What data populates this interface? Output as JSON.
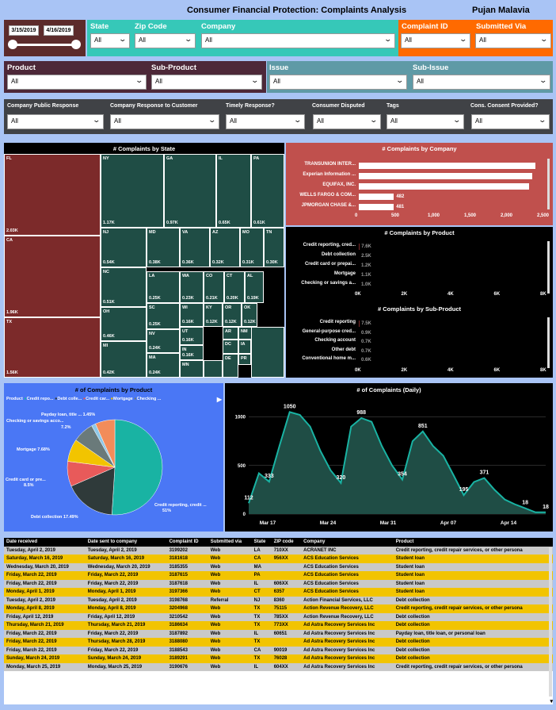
{
  "header": {
    "title": "Consumer Financial Protection: Complaints Analysis",
    "user": "Pujan Malavia"
  },
  "filters": {
    "date_from": "3/15/2019",
    "date_to": "4/16/2019",
    "row1": [
      {
        "label": "State",
        "value": "All"
      },
      {
        "label": "Zip Code",
        "value": "All"
      },
      {
        "label": "Company",
        "value": "All"
      },
      {
        "label": "Complaint ID",
        "value": "All"
      },
      {
        "label": "Submitted Via",
        "value": "All"
      }
    ],
    "row2": [
      {
        "label": "Product",
        "value": "All"
      },
      {
        "label": "Sub-Product",
        "value": "All"
      },
      {
        "label": "Issue",
        "value": "All"
      },
      {
        "label": "Sub-Issue",
        "value": "All"
      }
    ],
    "row3": [
      {
        "label": "Company Public Response",
        "value": "All"
      },
      {
        "label": "Company Response to Customer",
        "value": "All"
      },
      {
        "label": "Timely Response?",
        "value": "All"
      },
      {
        "label": "Consumer Disputed",
        "value": "All"
      },
      {
        "label": "Tags",
        "value": "All"
      },
      {
        "label": "Cons. Consent Provided?",
        "value": "All"
      }
    ]
  },
  "treemap": {
    "title": "# Complaints by State",
    "cells": [
      {
        "n": "FL",
        "v": "2.03K"
      },
      {
        "n": "CA",
        "v": "1.96K"
      },
      {
        "n": "TX",
        "v": "1.56K"
      },
      {
        "n": "NY",
        "v": "1.17K"
      },
      {
        "n": "GA",
        "v": "0.97K"
      },
      {
        "n": "IL",
        "v": "0.65K"
      },
      {
        "n": "PA",
        "v": "0.61K"
      },
      {
        "n": "NJ",
        "v": "0.54K"
      },
      {
        "n": "MD",
        "v": "0.38K"
      },
      {
        "n": "VA",
        "v": "0.36K"
      },
      {
        "n": "AZ",
        "v": "0.32K"
      },
      {
        "n": "MO",
        "v": "0.31K"
      },
      {
        "n": "TN",
        "v": "0.30K"
      },
      {
        "n": "NC",
        "v": "0.51K"
      },
      {
        "n": "LA",
        "v": "0.25K"
      },
      {
        "n": "WA",
        "v": "0.23K"
      },
      {
        "n": "CO",
        "v": "0.21K"
      },
      {
        "n": "CT",
        "v": "0.20K"
      },
      {
        "n": "AL",
        "v": "0.19K"
      },
      {
        "n": "OH",
        "v": "0.46K"
      },
      {
        "n": "SC",
        "v": "0.25K"
      },
      {
        "n": "WI",
        "v": "0.16K"
      },
      {
        "n": "KY",
        "v": "0.12K"
      },
      {
        "n": "OR",
        "v": "0.12K"
      },
      {
        "n": "OK",
        "v": "0.12K"
      },
      {
        "n": "NV",
        "v": "0.24K"
      },
      {
        "n": "UT",
        "v": "0.16K"
      },
      {
        "n": "AR",
        "v": ""
      },
      {
        "n": "NM",
        "v": ""
      },
      {
        "n": "MI",
        "v": "0.42K"
      },
      {
        "n": "MA",
        "v": "0.24K"
      },
      {
        "n": "IN",
        "v": "0.16K"
      },
      {
        "n": "DC",
        "v": ""
      },
      {
        "n": "IA",
        "v": ""
      },
      {
        "n": "MN",
        "v": ""
      },
      {
        "n": "DE",
        "v": ""
      },
      {
        "n": "PR",
        "v": ""
      }
    ]
  },
  "by_company": {
    "title": "# Complaints by Company",
    "labels": [
      "TRANSUNION INTER...",
      "Experian Information ...",
      "EQUIFAX, INC.",
      "WELLS FARGO & COM...",
      "JPMORGAN CHASE &..."
    ],
    "values": [
      2420,
      2380,
      2340,
      482,
      481
    ],
    "value_labels": [
      "",
      "",
      "",
      "482",
      "481"
    ],
    "ticks": [
      "0",
      "500",
      "1,000",
      "1,500",
      "2,000",
      "2,500"
    ]
  },
  "by_product": {
    "title": "# Complaints by Product",
    "labels": [
      "Credit reporting, cred...",
      "Debt collection",
      "Credit card or prepai...",
      "Mortgage",
      "Checking or savings a..."
    ],
    "values": [
      7.6,
      2.5,
      1.2,
      1.1,
      1.0
    ],
    "value_labels": [
      "7.6K",
      "2.5K",
      "1.2K",
      "1.1K",
      "1.0K"
    ],
    "ticks": [
      "0K",
      "2K",
      "4K",
      "6K",
      "8K"
    ]
  },
  "by_subproduct": {
    "title": "# Complaints by Sub-Product",
    "labels": [
      "Credit reporting",
      "General-purpose cred...",
      "Checking account",
      "Other debt",
      "Conventional home m..."
    ],
    "values": [
      7.5,
      0.9,
      0.7,
      0.7,
      0.6
    ],
    "value_labels": [
      "7.5K",
      "0.9K",
      "0.7K",
      "0.7K",
      "0.6K"
    ],
    "ticks": [
      "0K",
      "2K",
      "4K",
      "6K",
      "8K"
    ]
  },
  "pie": {
    "title": "# of Complaints by Product",
    "legend_title": "Product",
    "legend": [
      "Credit repo...",
      "Debt colle...",
      "Credit car...",
      "Mortgage",
      "Checking ..."
    ],
    "slices": [
      {
        "name": "Credit reporting, credit ...",
        "pct": 51,
        "label": "51%",
        "color": "#19b3a3"
      },
      {
        "name": "Debt collection",
        "pct": 17.49,
        "label": "17.49%",
        "color": "#2f3a3a"
      },
      {
        "name": "Credit card or pre...",
        "pct": 8.5,
        "label": "8.5%",
        "color": "#e85a5a"
      },
      {
        "name": "Mortgage",
        "pct": 7.68,
        "label": "7.68%",
        "color": "#f2c400"
      },
      {
        "name": "Checking or savings acco...",
        "pct": 7.2,
        "label": "7.2%",
        "color": "#6a7a7a"
      },
      {
        "name": "Payday loan, title ...",
        "pct": 1.45,
        "label": "1.45%",
        "color": "#8ec8e8"
      },
      {
        "name": "Other",
        "pct": 6.68,
        "label": "",
        "color": "#f28c5a"
      }
    ]
  },
  "daily": {
    "title": "# of Complaints (Daily)",
    "yticks": [
      "0",
      "500",
      "1000"
    ],
    "xticks": [
      "Mar 17",
      "Mar 24",
      "Mar 31",
      "Apr 07",
      "Apr 14"
    ],
    "values": [
      112,
      420,
      333,
      700,
      1050,
      1020,
      900,
      650,
      450,
      320,
      900,
      988,
      950,
      700,
      500,
      354,
      750,
      851,
      700,
      600,
      400,
      195,
      330,
      371,
      250,
      150,
      100,
      60,
      18,
      18
    ],
    "labels": [
      {
        "i": 0,
        "t": "112"
      },
      {
        "i": 2,
        "t": "333"
      },
      {
        "i": 4,
        "t": "1050"
      },
      {
        "i": 9,
        "t": "320"
      },
      {
        "i": 11,
        "t": "988"
      },
      {
        "i": 15,
        "t": "354"
      },
      {
        "i": 17,
        "t": "851"
      },
      {
        "i": 21,
        "t": "195"
      },
      {
        "i": 23,
        "t": "371"
      },
      {
        "i": 27,
        "t": "18"
      },
      {
        "i": 29,
        "t": "18"
      }
    ]
  },
  "table": {
    "headers": [
      "Date received",
      "Date sent to company",
      "Complaint ID",
      "Submitted via",
      "State",
      "ZIP code",
      "Company",
      "Product"
    ],
    "rows": [
      [
        "Tuesday, April 2, 2019",
        "Tuesday, April 2, 2019",
        "3199202",
        "Web",
        "LA",
        "710XX",
        "ACRANET INC",
        "Credit reporting, credit repair services, or other persona"
      ],
      [
        "Saturday, March 16, 2019",
        "Saturday, March 16, 2019",
        "3181618",
        "Web",
        "CA",
        "956XX",
        "ACS Education Services",
        "Student loan"
      ],
      [
        "Wednesday, March 20, 2019",
        "Wednesday, March 20, 2019",
        "3185355",
        "Web",
        "MA",
        "",
        "ACS Education Services",
        "Student loan"
      ],
      [
        "Friday, March 22, 2019",
        "Friday, March 22, 2019",
        "3187615",
        "Web",
        "PA",
        "",
        "ACS Education Services",
        "Student loan"
      ],
      [
        "Friday, March 22, 2019",
        "Friday, March 22, 2019",
        "3187618",
        "Web",
        "IL",
        "606XX",
        "ACS Education Services",
        "Student loan"
      ],
      [
        "Monday, April 1, 2019",
        "Monday, April 1, 2019",
        "3197366",
        "Web",
        "CT",
        "6357",
        "ACS Education Services",
        "Student loan"
      ],
      [
        "Tuesday, April 2, 2019",
        "Tuesday, April 2, 2019",
        "3198768",
        "Referral",
        "NJ",
        "8360",
        "Action Financial Services, LLC",
        "Debt collection"
      ],
      [
        "Monday, April 8, 2019",
        "Monday, April 8, 2019",
        "3204968",
        "Web",
        "TX",
        "75115",
        "Action Revenue Recovery, LLC",
        "Credit reporting, credit repair services, or other persona"
      ],
      [
        "Friday, April 12, 2019",
        "Friday, April 12, 2019",
        "3210542",
        "Web",
        "TX",
        "785XX",
        "Action Revenue Recovery, LLC",
        "Debt collection"
      ],
      [
        "Thursday, March 21, 2019",
        "Thursday, March 21, 2019",
        "3186634",
        "Web",
        "TX",
        "773XX",
        "Ad Astra Recovery Services Inc",
        "Debt collection"
      ],
      [
        "Friday, March 22, 2019",
        "Friday, March 22, 2019",
        "3187892",
        "Web",
        "IL",
        "60651",
        "Ad Astra Recovery Services Inc",
        "Payday loan, title loan, or personal loan"
      ],
      [
        "Friday, March 22, 2019",
        "Thursday, March 28, 2019",
        "3188080",
        "Web",
        "TX",
        "",
        "Ad Astra Recovery Services Inc",
        "Debt collection"
      ],
      [
        "Friday, March 22, 2019",
        "Friday, March 22, 2019",
        "3188543",
        "Web",
        "CA",
        "90019",
        "Ad Astra Recovery Services Inc",
        "Debt collection"
      ],
      [
        "Sunday, March 24, 2019",
        "Sunday, March 24, 2019",
        "3189291",
        "Web",
        "TX",
        "76028",
        "Ad Astra Recovery Services Inc",
        "Debt collection"
      ],
      [
        "Monday, March 25, 2019",
        "Monday, March 25, 2019",
        "3190676",
        "Web",
        "IL",
        "604XX",
        "Ad Astra Recovery Services Inc",
        "Credit reporting, credit repair services, or other persona"
      ]
    ]
  }
}
